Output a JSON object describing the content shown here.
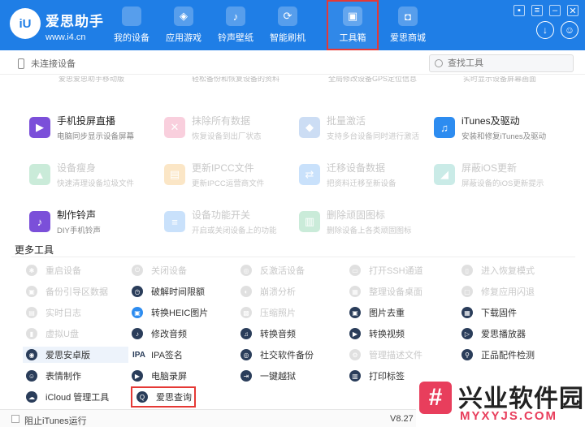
{
  "app": {
    "logo_text": "iU",
    "name": "爱思助手",
    "url": "www.i4.cn"
  },
  "nav": [
    {
      "label": "我的设备",
      "icon": "apple-icon",
      "glyph": ""
    },
    {
      "label": "应用游戏",
      "icon": "cube-icon",
      "glyph": "◈"
    },
    {
      "label": "铃声壁纸",
      "icon": "music-file-icon",
      "glyph": "♪"
    },
    {
      "label": "智能刷机",
      "icon": "refresh-icon",
      "glyph": "⟳"
    },
    {
      "label": "工具箱",
      "icon": "toolbox-icon",
      "glyph": "▣"
    },
    {
      "label": "爱思商城",
      "icon": "shopping-bag-icon",
      "glyph": "◘"
    }
  ],
  "active_nav": "工具箱",
  "device_status": "未连接设备",
  "search": {
    "placeholder": "查找工具"
  },
  "partial_row": [
    "爱思爱思助手移动版",
    "轻松备份和恢复设备的资料",
    "全局修改设备GPS定位信息",
    "实时显示设备屏幕画面"
  ],
  "tools": [
    {
      "title": "手机投屏直播",
      "desc": "电脑同步显示设备屏幕",
      "icon": "screen-mirror-icon",
      "color": "#7b4fd9",
      "glyph": "▶",
      "enabled": true
    },
    {
      "title": "抹除所有数据",
      "desc": "恢复设备到出厂状态",
      "icon": "erase-icon",
      "color": "#e8457a",
      "glyph": "✕",
      "enabled": false
    },
    {
      "title": "批量激活",
      "desc": "支持多台设备同时进行激活",
      "icon": "batch-activate-icon",
      "color": "#3a7bd5",
      "glyph": "◆",
      "enabled": false
    },
    {
      "title": "iTunes及驱动",
      "desc": "安装和修复iTunes及驱动",
      "icon": "itunes-icon",
      "color": "#2d8cf0",
      "glyph": "♫",
      "enabled": true
    },
    {
      "title": "设备瘦身",
      "desc": "快速清理设备垃圾文件",
      "icon": "broom-icon",
      "color": "#2fb36d",
      "glyph": "▲",
      "enabled": false
    },
    {
      "title": "更新IPCC文件",
      "desc": "更新IPCC运营商文件",
      "icon": "ipcc-file-icon",
      "color": "#f0a020",
      "glyph": "▤",
      "enabled": false
    },
    {
      "title": "迁移设备数据",
      "desc": "把资料迁移至新设备",
      "icon": "migrate-icon",
      "color": "#2d8cf0",
      "glyph": "⇄",
      "enabled": false
    },
    {
      "title": "屏蔽iOS更新",
      "desc": "屏蔽设备的iOS更新提示",
      "icon": "block-update-icon",
      "color": "#2fb3a3",
      "glyph": "◢",
      "enabled": false
    },
    {
      "title": "制作铃声",
      "desc": "DIY手机铃声",
      "icon": "ringtone-icon",
      "color": "#7b4fd9",
      "glyph": "♪",
      "enabled": true
    },
    {
      "title": "设备功能开关",
      "desc": "开启或关闭设备上的功能",
      "icon": "switch-icon",
      "color": "#2d8cf0",
      "glyph": "≡",
      "enabled": false
    },
    {
      "title": "删除顽固图标",
      "desc": "删除设备上各类顽固图标",
      "icon": "trash-icon",
      "color": "#2fb36d",
      "glyph": "▥",
      "enabled": false
    }
  ],
  "more_tools_title": "更多工具",
  "more_tools": [
    {
      "label": "重启设备",
      "icon": "restart-icon",
      "color": "#888",
      "glyph": "✱",
      "enabled": false
    },
    {
      "label": "关闭设备",
      "icon": "power-icon",
      "color": "#888",
      "glyph": "⏻",
      "enabled": false
    },
    {
      "label": "反激活设备",
      "icon": "deactivate-icon",
      "color": "#888",
      "glyph": "◎",
      "enabled": false
    },
    {
      "label": "打开SSH通道",
      "icon": "ssh-icon",
      "color": "#888",
      "glyph": "▭",
      "enabled": false
    },
    {
      "label": "进入恢复模式",
      "icon": "recovery-icon",
      "color": "#888",
      "glyph": "▯",
      "enabled": false
    },
    {
      "label": "备份引导区数据",
      "icon": "backup-boot-icon",
      "color": "#888",
      "glyph": "▣",
      "enabled": false
    },
    {
      "label": "破解时间限额",
      "icon": "time-limit-icon",
      "color": "#2a3d5a",
      "glyph": "◷",
      "enabled": true
    },
    {
      "label": "崩溃分析",
      "icon": "crash-analysis-icon",
      "color": "#888",
      "glyph": "◐",
      "enabled": false
    },
    {
      "label": "整理设备桌面",
      "icon": "desktop-icon",
      "color": "#888",
      "glyph": "▦",
      "enabled": false
    },
    {
      "label": "修复应用闪退",
      "icon": "fix-crash-icon",
      "color": "#888",
      "glyph": "▢",
      "enabled": false
    },
    {
      "label": "实时日志",
      "icon": "log-icon",
      "color": "#888",
      "glyph": "▤",
      "enabled": false
    },
    {
      "label": "转换HEIC图片",
      "icon": "heic-icon",
      "color": "#2d8cf0",
      "glyph": "▣",
      "enabled": true
    },
    {
      "label": "压缩照片",
      "icon": "compress-icon",
      "color": "#888",
      "glyph": "▩",
      "enabled": false
    },
    {
      "label": "图片去重",
      "icon": "dedupe-icon",
      "color": "#2a3d5a",
      "glyph": "▣",
      "enabled": true
    },
    {
      "label": "下载固件",
      "icon": "firmware-icon",
      "color": "#2a3d5a",
      "glyph": "▦",
      "enabled": true
    },
    {
      "label": "虚拟U盘",
      "icon": "usb-icon",
      "color": "#888",
      "glyph": "▮",
      "enabled": false
    },
    {
      "label": "修改音频",
      "icon": "audio-edit-icon",
      "color": "#2a3d5a",
      "glyph": "♪",
      "enabled": true
    },
    {
      "label": "转换音频",
      "icon": "audio-convert-icon",
      "color": "#2a3d5a",
      "glyph": "♫",
      "enabled": true
    },
    {
      "label": "转换视频",
      "icon": "video-convert-icon",
      "color": "#2a3d5a",
      "glyph": "▶",
      "enabled": true
    },
    {
      "label": "爱思播放器",
      "icon": "player-icon",
      "color": "#2a3d5a",
      "glyph": "▷",
      "enabled": true
    },
    {
      "label": "爱思安卓版",
      "icon": "android-icon",
      "color": "#2a3d5a",
      "glyph": "◉",
      "enabled": true
    },
    {
      "label": "IPA签名",
      "icon": "ipa-sign-icon",
      "color": "#2a3d5a",
      "glyph": "IPA",
      "enabled": true
    },
    {
      "label": "社交软件备份",
      "icon": "social-backup-icon",
      "color": "#2a3d5a",
      "glyph": "◎",
      "enabled": true
    },
    {
      "label": "管理描述文件",
      "icon": "profile-icon",
      "color": "#888",
      "glyph": "⚙",
      "enabled": false
    },
    {
      "label": "正品配件检测",
      "icon": "accessory-check-icon",
      "color": "#2a3d5a",
      "glyph": "⚲",
      "enabled": true
    },
    {
      "label": "表情制作",
      "icon": "emoji-icon",
      "color": "#2a3d5a",
      "glyph": "☺",
      "enabled": true
    },
    {
      "label": "电脑录屏",
      "icon": "screen-record-icon",
      "color": "#2a3d5a",
      "glyph": "▶",
      "enabled": true
    },
    {
      "label": "一键越狱",
      "icon": "jailbreak-icon",
      "color": "#2a3d5a",
      "glyph": "⇥",
      "enabled": true
    },
    {
      "label": "打印标签",
      "icon": "print-icon",
      "color": "#2a3d5a",
      "glyph": "▥",
      "enabled": true
    },
    {
      "label": "",
      "icon": "",
      "color": "#fff",
      "glyph": "",
      "enabled": false
    },
    {
      "label": "iCloud 管理工具",
      "icon": "icloud-icon",
      "color": "#2a3d5a",
      "glyph": "☁",
      "enabled": true
    },
    {
      "label": "爱思查询",
      "icon": "query-icon",
      "color": "#2a3d5a",
      "glyph": "Q",
      "enabled": true
    }
  ],
  "footer": {
    "checkbox_label": "阻止iTunes运行",
    "version": "V8.27"
  },
  "watermark": {
    "mark": "#",
    "text": "兴业软件园",
    "url": "MYXYJS.COM"
  },
  "colors": {
    "brand": "#1f7ee6",
    "highlight_box": "#e53935"
  }
}
